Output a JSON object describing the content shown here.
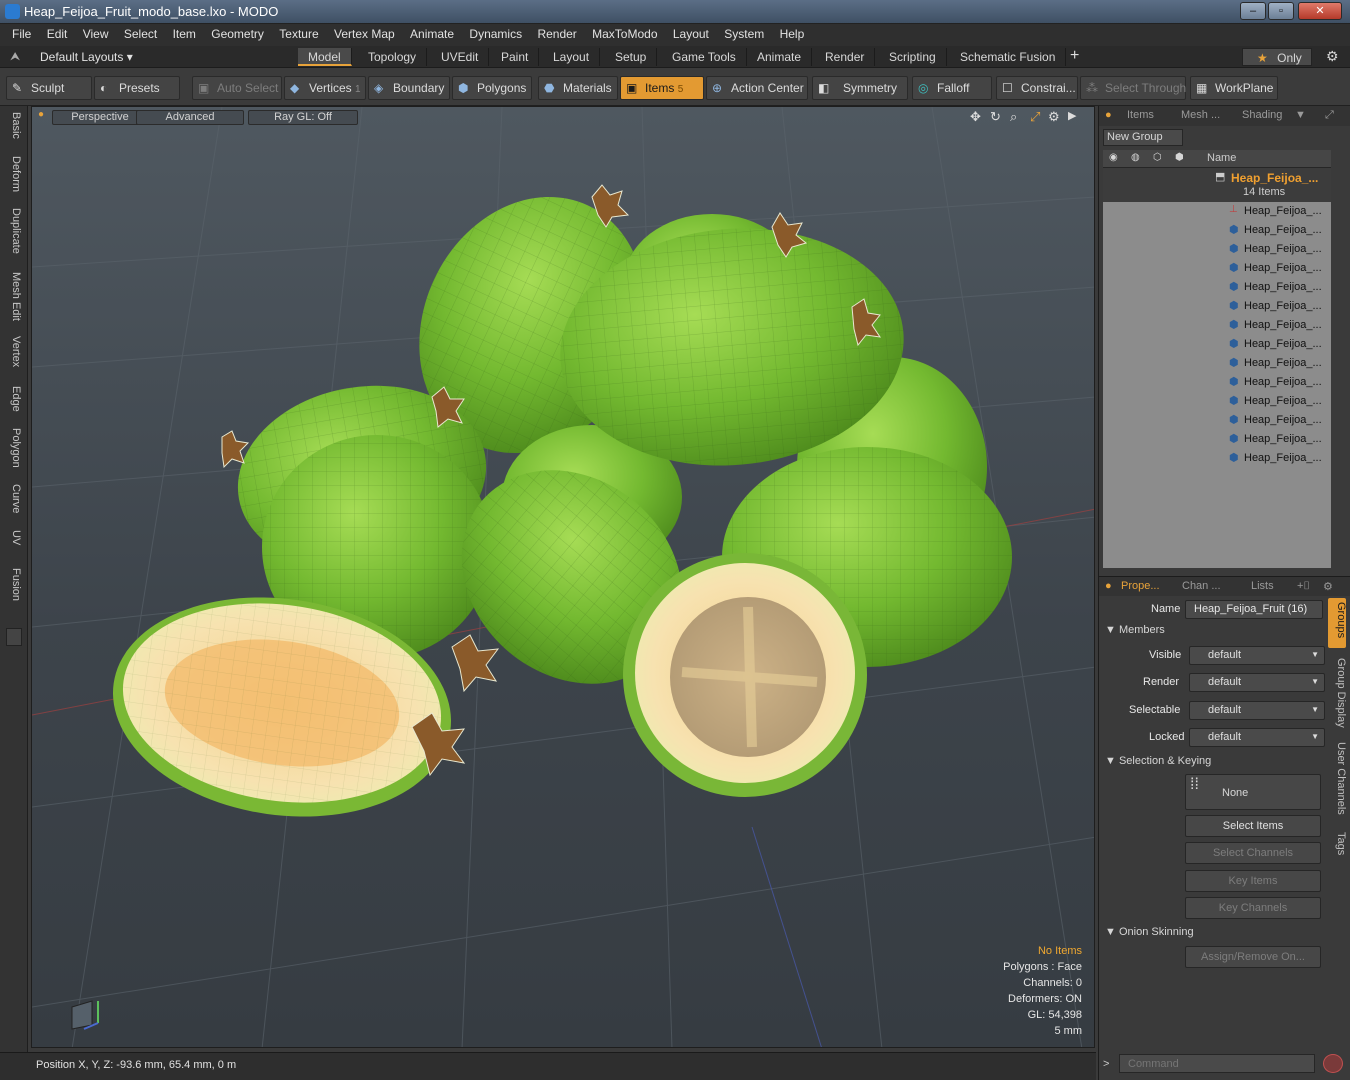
{
  "window": {
    "title": "Heap_Feijoa_Fruit_modo_base.lxo - MODO"
  },
  "menu": [
    "File",
    "Edit",
    "View",
    "Select",
    "Item",
    "Geometry",
    "Texture",
    "Vertex Map",
    "Animate",
    "Dynamics",
    "Render",
    "MaxToModo",
    "Layout",
    "System",
    "Help"
  ],
  "layouts": {
    "selector": "Default Layouts ▾",
    "tabs": [
      "Model",
      "Topology",
      "UVEdit",
      "Paint",
      "Layout",
      "Setup",
      "Game Tools",
      "Animate",
      "Render",
      "Scripting",
      "Schematic Fusion"
    ],
    "active": "Model",
    "only_label": "Only"
  },
  "toolbar": {
    "sculpt": "Sculpt",
    "presets": "Presets",
    "auto_select": "Auto Select",
    "vertices": "Vertices",
    "vertices_count": "1",
    "boundary": "Boundary",
    "polygons": "Polygons",
    "materials": "Materials",
    "items": "Items",
    "items_count": "5",
    "action_center": "Action Center",
    "symmetry": "Symmetry",
    "falloff": "Falloff",
    "constraints": "Constrai...",
    "select_through": "Select Through",
    "workplane": "WorkPlane"
  },
  "left_tabs": [
    "Basic",
    "Deform",
    "Duplicate",
    "Mesh Edit",
    "Vertex",
    "Edge",
    "Polygon",
    "Curve",
    "UV",
    "Fusion"
  ],
  "viewport": {
    "view": "Perspective",
    "shading": "Advanced",
    "raygl": "Ray GL: Off",
    "stats": {
      "selection": "No Items",
      "polygons": "Polygons : Face",
      "channels": "Channels: 0",
      "deformers": "Deformers: ON",
      "gl": "GL: 54,398",
      "scale": "5 mm"
    }
  },
  "statusbar": {
    "position": "Position X, Y, Z:   -93.6 mm, 65.4 mm, 0 m"
  },
  "items_panel": {
    "tabs": [
      "Items",
      "Mesh ...",
      "Shading"
    ],
    "new_group": "New Group",
    "name_header": "Name",
    "group_name": "Heap_Feijoa_...",
    "group_count": "14 Items",
    "children": [
      "Heap_Feijoa_...",
      "Heap_Feijoa_...",
      "Heap_Feijoa_...",
      "Heap_Feijoa_...",
      "Heap_Feijoa_...",
      "Heap_Feijoa_...",
      "Heap_Feijoa_...",
      "Heap_Feijoa_...",
      "Heap_Feijoa_...",
      "Heap_Feijoa_...",
      "Heap_Feijoa_...",
      "Heap_Feijoa_...",
      "Heap_Feijoa_...",
      "Heap_Feijoa_..."
    ]
  },
  "properties": {
    "tabs": [
      "Prope...",
      "Chan ...",
      "Lists"
    ],
    "name_label": "Name",
    "name_value": "Heap_Feijoa_Fruit (16)",
    "members": "Members",
    "visible": "Visible",
    "render": "Render",
    "selectable": "Selectable",
    "locked": "Locked",
    "dropdown_value": "default",
    "selection_keying": "Selection & Keying",
    "none": "None",
    "select_items": "Select Items",
    "select_channels": "Select Channels",
    "key_items": "Key Items",
    "key_channels": "Key Channels",
    "onion": "Onion Skinning",
    "assign": "Assign/Remove On...",
    "side_tabs": [
      "Groups",
      "Group Display",
      "User Channels",
      "Tags"
    ],
    "command_placeholder": "Command"
  },
  "colors": {
    "accent": "#e8a33a",
    "fruit_green": "#7fc03a",
    "flesh": "#f2d9a0"
  }
}
